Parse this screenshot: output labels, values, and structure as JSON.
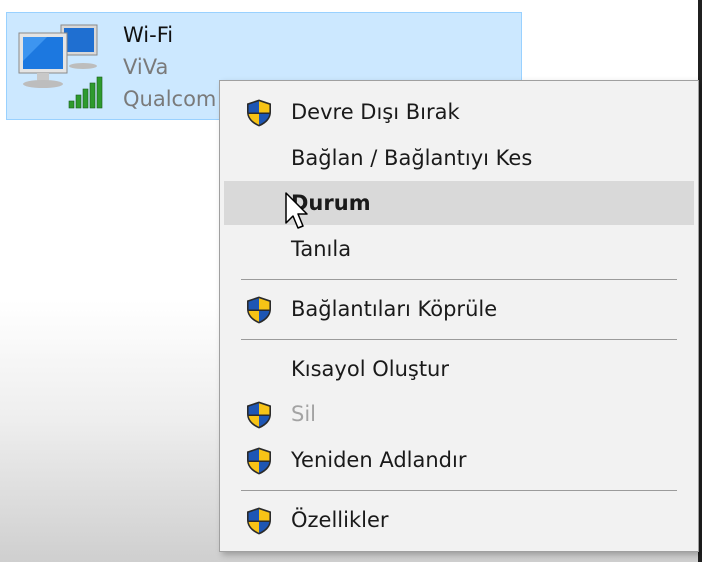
{
  "adapter": {
    "name": "Wi-Fi",
    "network": "ViVa",
    "device": "Qualcom",
    "icon": "network-adapter-icon",
    "signal_icon": "wifi-signal-bars-icon"
  },
  "context_menu": {
    "items": [
      {
        "label": "Devre Dışı Bırak",
        "icon": "uac-shield-icon",
        "enabled": true,
        "bold": false
      },
      {
        "label": "Bağlan / Bağlantıyı Kes",
        "icon": "",
        "enabled": true,
        "bold": false
      },
      {
        "label": "Durum",
        "icon": "",
        "enabled": true,
        "bold": true,
        "highlighted": true
      },
      {
        "label": "Tanıla",
        "icon": "",
        "enabled": true,
        "bold": false
      },
      {
        "label": "Bağlantıları Köprüle",
        "icon": "uac-shield-icon",
        "enabled": true,
        "bold": false
      },
      {
        "label": "Kısayol Oluştur",
        "icon": "",
        "enabled": true,
        "bold": false
      },
      {
        "label": "Sil",
        "icon": "uac-shield-icon",
        "enabled": false,
        "bold": false
      },
      {
        "label": "Yeniden Adlandır",
        "icon": "uac-shield-icon",
        "enabled": true,
        "bold": false
      },
      {
        "label": "Özellikler",
        "icon": "uac-shield-icon",
        "enabled": true,
        "bold": false
      }
    ]
  },
  "colors": {
    "selection_bg": "#cce8ff",
    "selection_border": "#99d1ff",
    "menu_bg": "#f2f2f2",
    "menu_highlight": "#d9d9d9",
    "shield_blue": "#1e56b4",
    "shield_yellow": "#f7c316"
  }
}
